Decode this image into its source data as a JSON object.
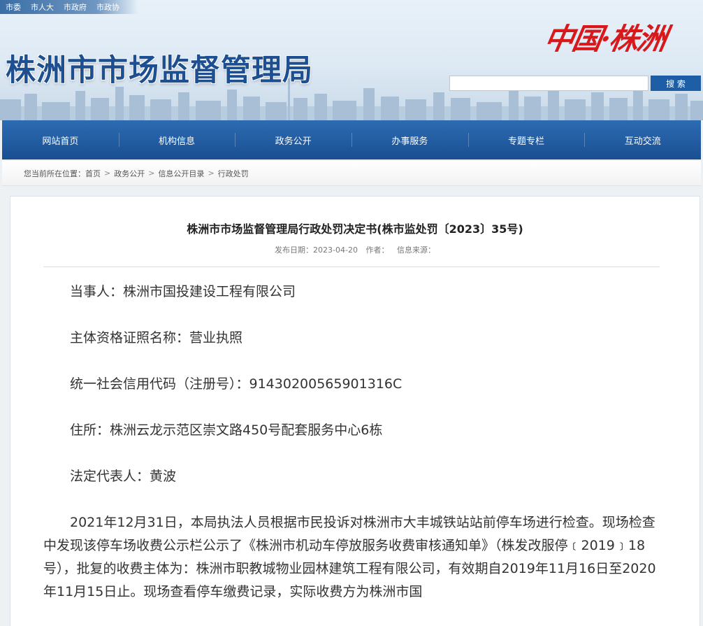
{
  "toplinks": [
    "市委",
    "市人大",
    "市政府",
    "市政协"
  ],
  "site_title": "株洲市市场监督管理局",
  "logo_text": "中国·株洲",
  "search": {
    "placeholder": "",
    "button_label": "搜 索"
  },
  "nav": [
    "网站首页",
    "机构信息",
    "政务公开",
    "办事服务",
    "专题专栏",
    "互动交流"
  ],
  "breadcrumb": {
    "prefix": "您当前所在位置：",
    "items": [
      "首页",
      "政务公开",
      "信息公开目录",
      "行政处罚"
    ]
  },
  "article": {
    "title": "株洲市市场监督管理局行政处罚决定书(株市监处罚〔2023〕35号)",
    "meta": {
      "date": "发布日期：2023-04-20",
      "author": "作者：",
      "source": "信息来源："
    },
    "paragraphs": [
      "当事人：株洲市国投建设工程有限公司",
      "主体资格证照名称：营业执照",
      "统一社会信用代码（注册号）：91430200565901316C",
      "住所：株洲云龙示范区崇文路450号配套服务中心6栋",
      "法定代表人：黄波",
      "2021年12月31日，本局执法人员根据市民投诉对株洲市大丰城铁站站前停车场进行检查。现场检查中发现该停车场收费公示栏公示了《株洲市机动车停放服务收费审核通知单》（株发改服停﹝2019﹞18号），批复的收费主体为：株洲市职教城物业园林建筑工程有限公司，有效期自2019年11月16日至2020年11月15日止。现场查看停车缴费记录，实际收费方为株洲市国"
    ]
  },
  "colors": {
    "primary": "#1e5ea6",
    "nav": "#2d6bb3",
    "title": "#1d4f91",
    "logo": "#d8191c"
  }
}
